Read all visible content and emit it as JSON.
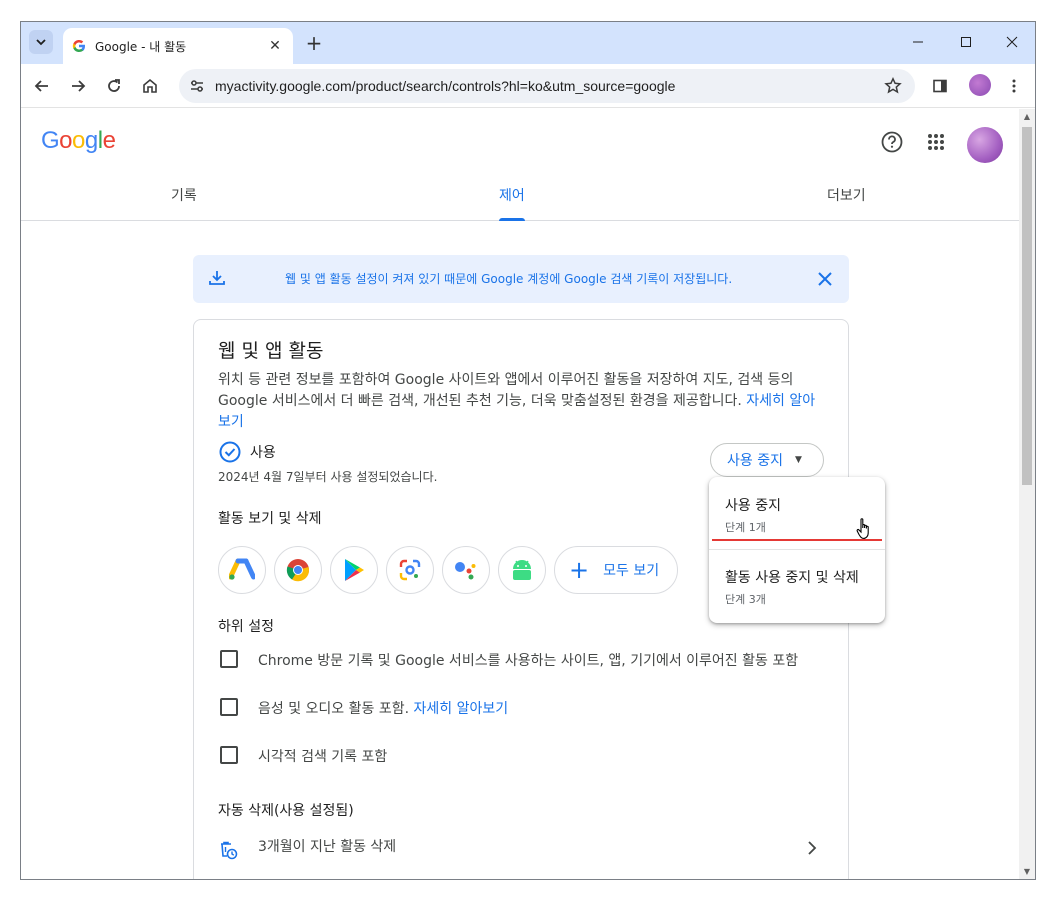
{
  "browser": {
    "tab_title": "Google - 내 활동",
    "url": "myactivity.google.com/product/search/controls?hl=ko&utm_source=google"
  },
  "header": {
    "logo_text": "Google",
    "tabs": [
      {
        "label": "기록"
      },
      {
        "label": "제어"
      },
      {
        "label": "더보기"
      }
    ],
    "active_tab": "제어"
  },
  "banner": {
    "text": "웹 및 앱 활동 설정이 켜져 있기 때문에 Google 계정에 Google 검색 기록이 저장됩니다."
  },
  "card": {
    "title": "웹 및 앱 활동",
    "description": "위치 등 관련 정보를 포함하여 Google 사이트와 앱에서 이루어진 활동을 저장하여 지도, 검색 등의 Google 서비스에서 더 빠른 검색, 개선된 추천 기능, 더욱 맞춤설정된 환경을 제공합니다.",
    "learn_more": "자세히 알아보기",
    "status_label": "사용",
    "status_date": "2024년 4월 7일부터 사용 설정되었습니다.",
    "stop_button": "사용 중지",
    "view_delete_label": "활동 보기 및 삭제",
    "see_all_label": "모두 보기",
    "sub_settings_label": "하위 설정",
    "checkboxes": [
      {
        "label": "Chrome 방문 기록 및 Google 서비스를 사용하는 사이트, 앱, 기기에서 이루어진 활동 포함",
        "checked": false
      },
      {
        "label": "음성 및 오디오 활동 포함.",
        "link": "자세히 알아보기",
        "checked": false
      },
      {
        "label": "시각적 검색 기록 포함",
        "checked": false
      }
    ],
    "auto_delete_label": "자동 삭제(사용 설정됨)",
    "auto_delete_value": "3개월이 지난 활동 삭제"
  },
  "menu": {
    "items": [
      {
        "title": "사용 중지",
        "subtitle": "단계 1개"
      },
      {
        "title": "활동 사용 중지 및 삭제",
        "subtitle": "단계 3개"
      }
    ]
  },
  "colors": {
    "accent": "#1a73e8",
    "tabbar": "#d3e3fd",
    "highlight_underline": "#e53935"
  }
}
